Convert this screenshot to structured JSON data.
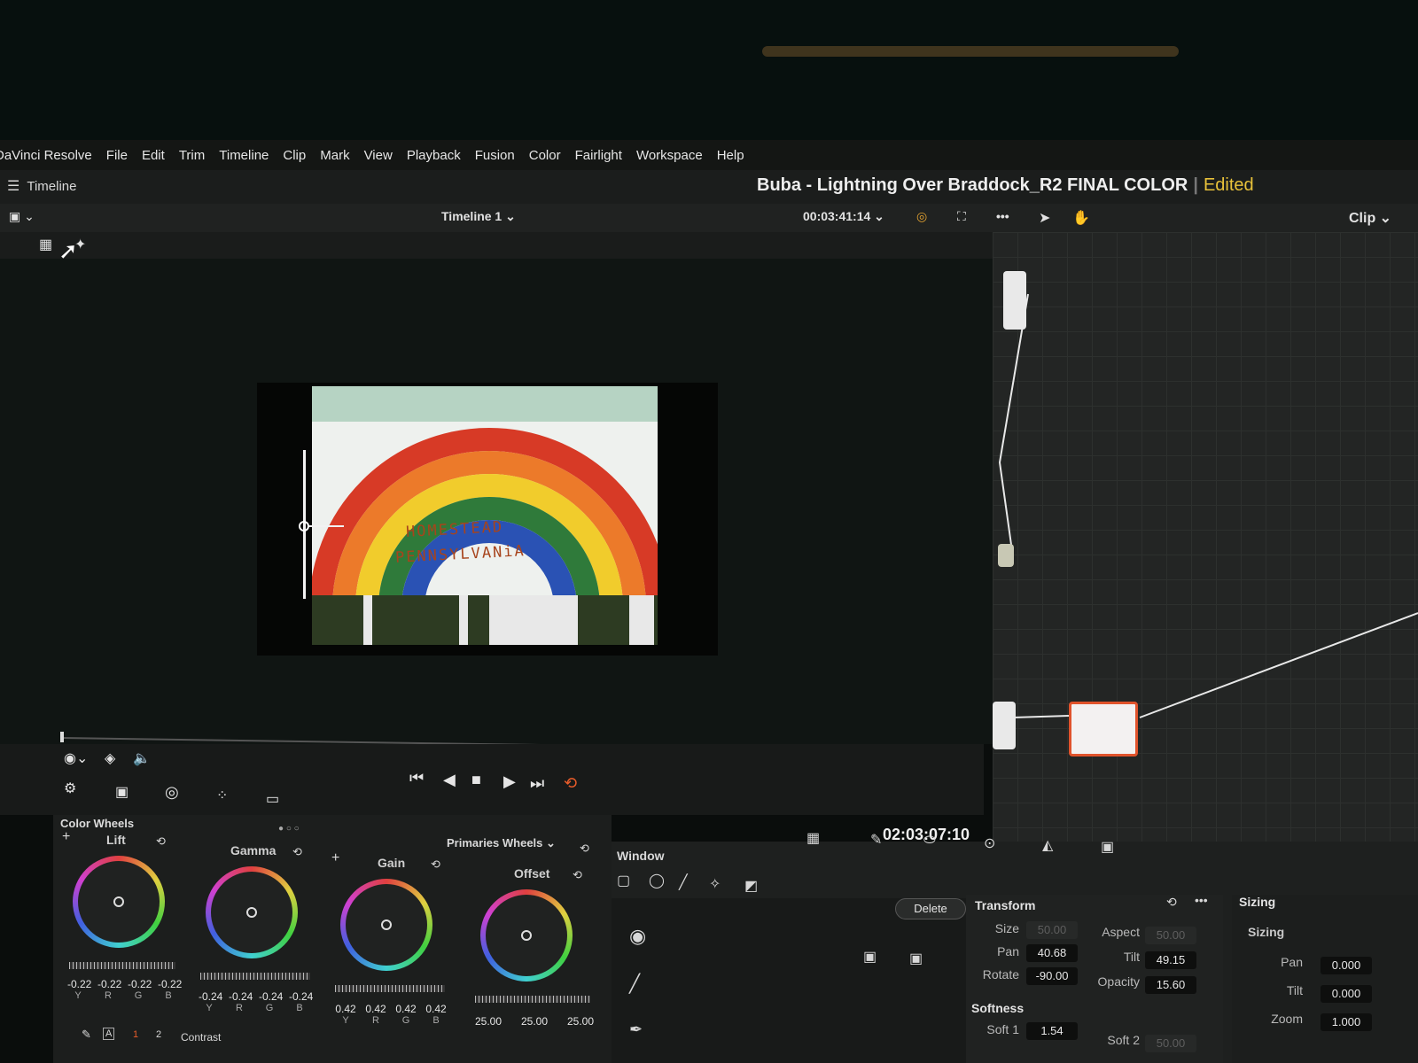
{
  "menu": [
    "DaVinci Resolve",
    "File",
    "Edit",
    "Trim",
    "Timeline",
    "Clip",
    "Mark",
    "View",
    "Playback",
    "Fusion",
    "Color",
    "Fairlight",
    "Workspace",
    "Help"
  ],
  "header": {
    "panel_label": "Timeline",
    "project_title": "Buba - Lightning Over Braddock_R2 FINAL COLOR",
    "project_status": "Edited"
  },
  "viewer": {
    "timeline_name": "Timeline 1",
    "source_timecode": "00:03:41:14",
    "record_timecode": "02:03:07:10",
    "node_mode": "Clip"
  },
  "frame_text": {
    "line1": "HOMESTEAD",
    "line2": "PENNSYLVANiA"
  },
  "color_wheels": {
    "panel_title": "Color Wheels",
    "mode": "Primaries Wheels",
    "wheels": [
      {
        "name": "Lift",
        "values": [
          "-0.22",
          "-0.22",
          "-0.22",
          "-0.22"
        ]
      },
      {
        "name": "Gamma",
        "values": [
          "-0.24",
          "-0.24",
          "-0.24",
          "-0.24"
        ]
      },
      {
        "name": "Gain",
        "values": [
          "0.42",
          "0.42",
          "0.42",
          "0.42"
        ]
      },
      {
        "name": "Offset",
        "values": [
          "25.00",
          "25.00",
          "25.00"
        ]
      }
    ],
    "channels": [
      "Y",
      "R",
      "G",
      "B"
    ],
    "pages": [
      "1",
      "2"
    ],
    "contrast_label": "Contrast"
  },
  "window": {
    "title": "Window",
    "delete_label": "Delete"
  },
  "transform": {
    "title": "Transform",
    "size_label": "Size",
    "size": "50.00",
    "aspect_label": "Aspect",
    "aspect": "50.00",
    "pan_label": "Pan",
    "pan": "40.68",
    "tilt_label": "Tilt",
    "tilt": "49.15",
    "rotate_label": "Rotate",
    "rotate": "-90.00",
    "opacity_label": "Opacity",
    "opacity": "15.60",
    "softness_title": "Softness",
    "soft1_label": "Soft 1",
    "soft1": "1.54",
    "soft2_label": "Soft 2",
    "soft2": "50.00"
  },
  "sizing": {
    "tab_title": "Sizing",
    "section_title": "Sizing",
    "pan_label": "Pan",
    "pan": "0.000",
    "tilt_label": "Tilt",
    "tilt": "0.000",
    "zoom_label": "Zoom",
    "zoom": "1.000"
  },
  "colors": {
    "accent_orange": "#e0532c",
    "status_yellow": "#e9c23a",
    "loop_orange": "#e85c2a"
  }
}
